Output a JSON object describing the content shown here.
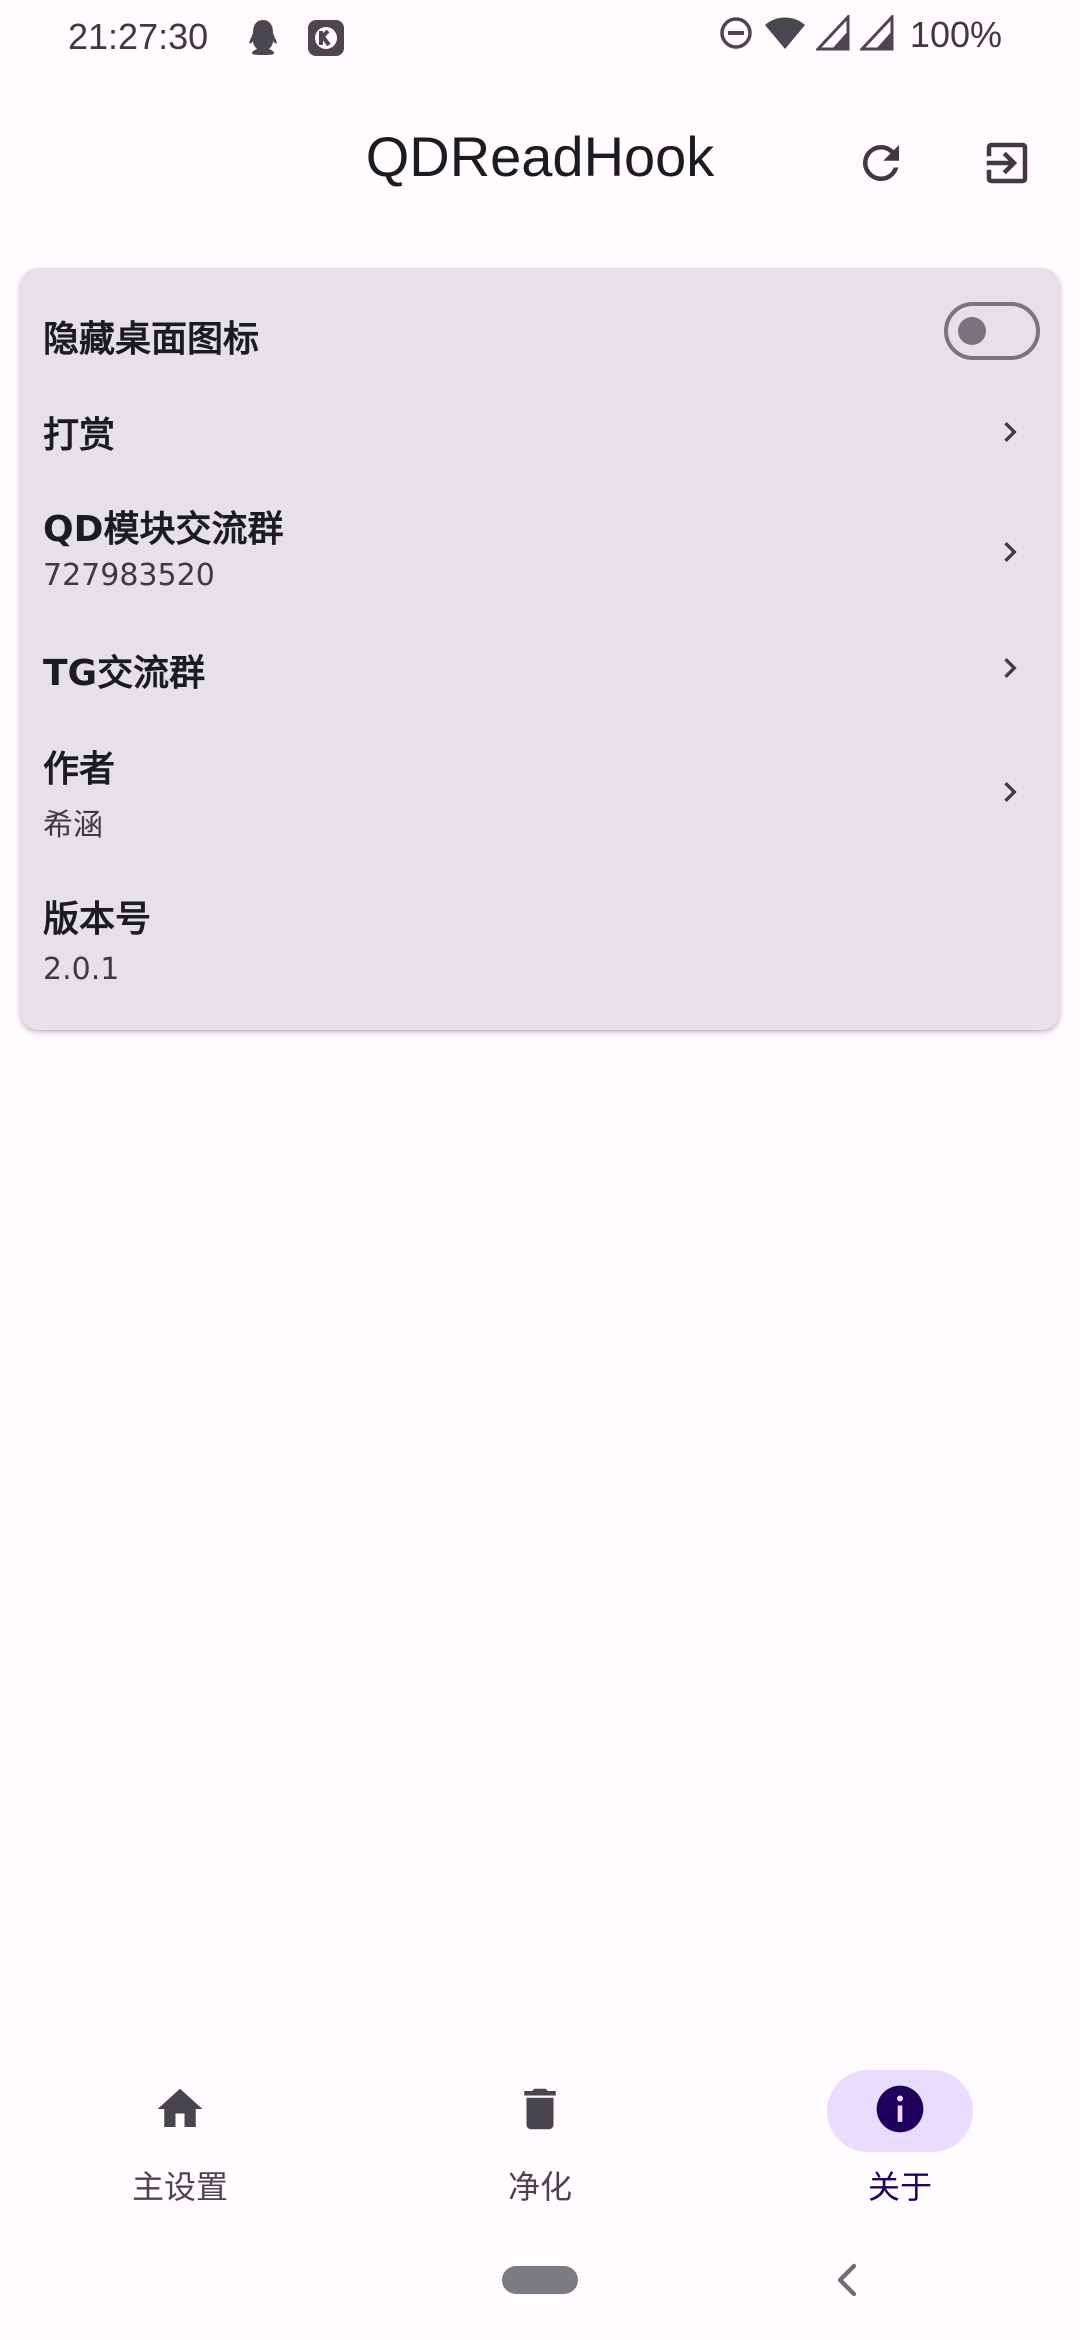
{
  "status_bar": {
    "time": "21:27:30",
    "battery": "100%",
    "icons": [
      "qq-icon",
      "app-notification-icon",
      "dnd-icon",
      "wifi-icon",
      "signal-icon",
      "signal-icon-2"
    ]
  },
  "app_bar": {
    "title": "QDReadHook",
    "actions": [
      "refresh-icon",
      "exit-icon"
    ]
  },
  "settings": {
    "hide_icon": {
      "title": "隐藏桌面图标",
      "enabled": false
    },
    "donate": {
      "title": "打赏"
    },
    "qd_group": {
      "title": "QD模块交流群",
      "subtitle": "727983520"
    },
    "tg_group": {
      "title": "TG交流群"
    },
    "author": {
      "title": "作者",
      "subtitle": "希涵"
    },
    "version": {
      "title": "版本号",
      "subtitle": "2.0.1"
    }
  },
  "bottom_nav": {
    "items": [
      {
        "label": "主设置",
        "icon": "home-icon",
        "active": false
      },
      {
        "label": "净化",
        "icon": "trash-icon",
        "active": false
      },
      {
        "label": "关于",
        "icon": "info-icon",
        "active": true
      }
    ]
  },
  "colors": {
    "background": "#fffbfe",
    "card": "#e6e0e9",
    "active_pill": "#e8ddff",
    "active_text": "#21005d",
    "text": "#1c1b1f"
  }
}
